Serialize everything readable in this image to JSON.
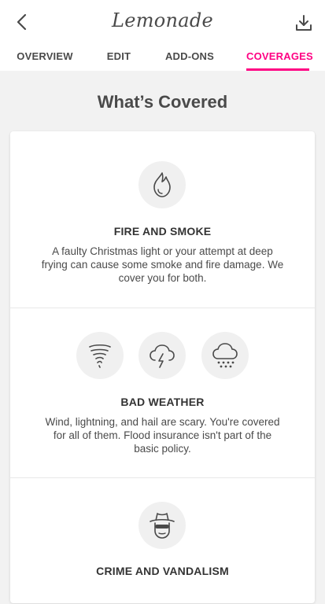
{
  "header": {
    "logo": "Lemonade",
    "back_icon": "chevron-left-icon",
    "download_icon": "download-icon"
  },
  "tabs": [
    {
      "label": "OVERVIEW",
      "active": false
    },
    {
      "label": "EDIT",
      "active": false
    },
    {
      "label": "ADD-ONS",
      "active": false
    },
    {
      "label": "COVERAGES",
      "active": true
    }
  ],
  "colors": {
    "accent": "#ff0083",
    "text": "#4a4a4a",
    "background": "#f2f2f2"
  },
  "page": {
    "title": "What’s Covered"
  },
  "coverages": [
    {
      "icons": [
        "fire-icon"
      ],
      "title": "FIRE AND SMOKE",
      "description": "A faulty Christmas light or your attempt at deep frying can cause some smoke and fire damage. We cover you for both."
    },
    {
      "icons": [
        "tornado-icon",
        "lightning-icon",
        "hail-icon"
      ],
      "title": "BAD WEATHER",
      "description": "Wind, lightning, and hail are scary. You're covered for all of them. Flood insurance isn't part of the basic policy."
    },
    {
      "icons": [
        "burglar-icon"
      ],
      "title": "CRIME AND VANDALISM",
      "description": ""
    }
  ]
}
